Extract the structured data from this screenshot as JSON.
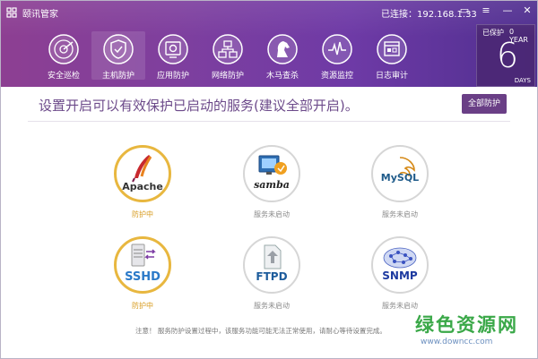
{
  "app": {
    "title": "颐讯管家",
    "connection_status": "已连接：192.168.1.33"
  },
  "window_controls": {
    "message": "▭",
    "menu": "≡",
    "minimize": "—",
    "close": "✕"
  },
  "nav": [
    {
      "label": "安全巡检",
      "icon": "radar-icon"
    },
    {
      "label": "主机防护",
      "icon": "shield-icon",
      "active": true
    },
    {
      "label": "应用防护",
      "icon": "app-gear-icon"
    },
    {
      "label": "网络防护",
      "icon": "network-icon"
    },
    {
      "label": "木马查杀",
      "icon": "trojan-horse-icon"
    },
    {
      "label": "资源监控",
      "icon": "monitor-pulse-icon"
    },
    {
      "label": "日志审计",
      "icon": "log-icon"
    }
  ],
  "protection_days": {
    "label": "已保护",
    "years": "0 YEAR",
    "days": "6",
    "unit": "DAYS"
  },
  "main": {
    "hint": "设置开启可以有效保护已启动的服务(建议全部开启)。",
    "protect_all_label": "全部防护",
    "services": [
      {
        "name": "Apache",
        "status": "防护中",
        "on": true,
        "icon": "apache-feather-icon"
      },
      {
        "name": "samba",
        "status": "服务未启动",
        "on": false,
        "icon": "samba-icon"
      },
      {
        "name": "MySQL",
        "status": "服务未启动",
        "on": false,
        "icon": "mysql-dolphin-icon"
      },
      {
        "name": "SSHD",
        "status": "防护中",
        "on": true,
        "icon": "sshd-server-icon"
      },
      {
        "name": "FTPD",
        "status": "服务未启动",
        "on": false,
        "icon": "ftpd-icon"
      },
      {
        "name": "SNMP",
        "status": "服务未启动",
        "on": false,
        "icon": "snmp-network-icon"
      }
    ],
    "footer_note": "注意！ 服务防护设置过程中，该服务功能可能无法正常使用，请耐心等待设置完成。"
  },
  "watermark": {
    "text": "绿色资源网",
    "url": "www.downcc.com"
  },
  "colors": {
    "header": "#7d3f9f",
    "accent": "#6a3f86",
    "active_ring": "#e8b73f",
    "status_on": "#d79a1c",
    "watermark": "#3aa848"
  }
}
